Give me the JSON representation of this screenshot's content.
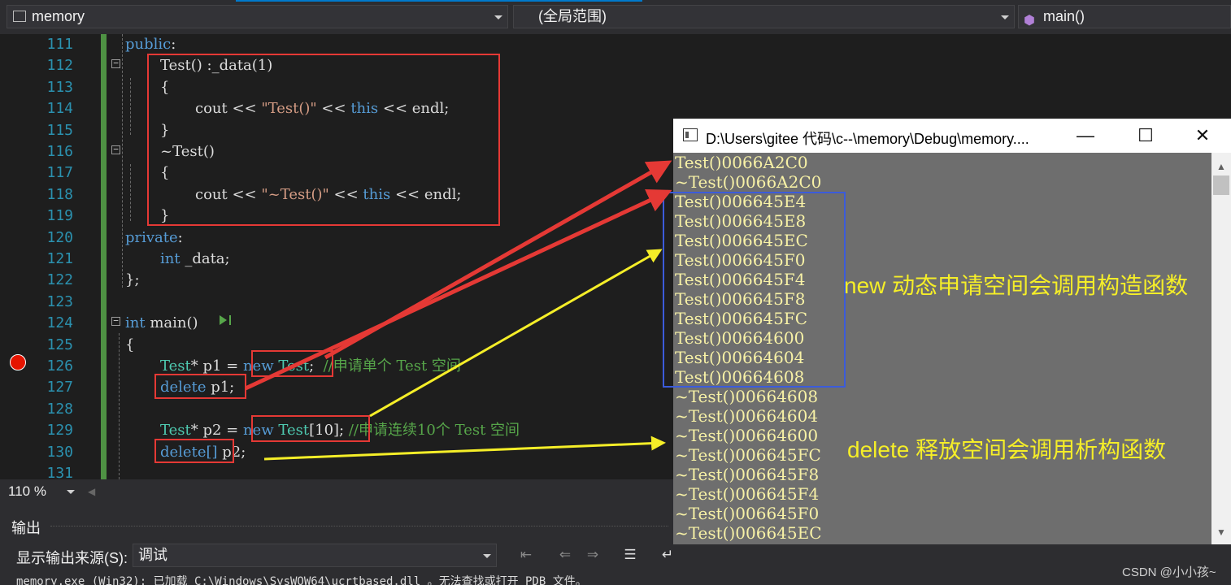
{
  "nav": {
    "scope_file": "memory",
    "scope_global": "(全局范围)",
    "scope_func": "main()"
  },
  "code_lines": [
    {
      "n": "111",
      "parts": [
        {
          "t": "public",
          "c": "kw"
        },
        {
          "t": ":",
          "c": "pl"
        }
      ]
    },
    {
      "n": "112",
      "parts": [
        {
          "t": "Test() :_data(1)",
          "c": "pl"
        }
      ]
    },
    {
      "n": "113",
      "parts": [
        {
          "t": "{",
          "c": "pl"
        }
      ]
    },
    {
      "n": "114",
      "parts": [
        {
          "t": "cout << ",
          "c": "pl"
        },
        {
          "t": "\"Test()\"",
          "c": "st"
        },
        {
          "t": " << ",
          "c": "pl"
        },
        {
          "t": "this",
          "c": "kw"
        },
        {
          "t": " << endl;",
          "c": "pl"
        }
      ]
    },
    {
      "n": "115",
      "parts": [
        {
          "t": "}",
          "c": "pl"
        }
      ]
    },
    {
      "n": "116",
      "parts": [
        {
          "t": "~Test()",
          "c": "pl"
        }
      ]
    },
    {
      "n": "117",
      "parts": [
        {
          "t": "{",
          "c": "pl"
        }
      ]
    },
    {
      "n": "118",
      "parts": [
        {
          "t": "cout << ",
          "c": "pl"
        },
        {
          "t": "\"~Test()\"",
          "c": "st"
        },
        {
          "t": " << ",
          "c": "pl"
        },
        {
          "t": "this",
          "c": "kw"
        },
        {
          "t": " << endl;",
          "c": "pl"
        }
      ]
    },
    {
      "n": "119",
      "parts": [
        {
          "t": "}",
          "c": "pl"
        }
      ]
    },
    {
      "n": "120",
      "parts": [
        {
          "t": "private",
          "c": "kw"
        },
        {
          "t": ":",
          "c": "pl"
        }
      ]
    },
    {
      "n": "121",
      "parts": [
        {
          "t": "int",
          "c": "kw"
        },
        {
          "t": " _data;",
          "c": "pl"
        }
      ]
    },
    {
      "n": "122",
      "parts": [
        {
          "t": "};",
          "c": "pl"
        }
      ]
    },
    {
      "n": "123",
      "parts": []
    },
    {
      "n": "124",
      "parts": [
        {
          "t": "int",
          "c": "kw"
        },
        {
          "t": " main()",
          "c": "pl"
        }
      ]
    },
    {
      "n": "125",
      "parts": [
        {
          "t": "{",
          "c": "pl"
        }
      ]
    },
    {
      "n": "126",
      "parts": [
        {
          "t": "Test",
          "c": "ty"
        },
        {
          "t": "* p1 = ",
          "c": "pl"
        },
        {
          "t": "new",
          "c": "kw"
        },
        {
          "t": " ",
          "c": "pl"
        },
        {
          "t": "Test",
          "c": "ty"
        },
        {
          "t": ";  ",
          "c": "pl"
        },
        {
          "t": "//申请单个 Test 空间",
          "c": "cm"
        }
      ]
    },
    {
      "n": "127",
      "parts": [
        {
          "t": "delete",
          "c": "kw"
        },
        {
          "t": " p1;",
          "c": "pl"
        }
      ]
    },
    {
      "n": "128",
      "parts": []
    },
    {
      "n": "129",
      "parts": [
        {
          "t": "Test",
          "c": "ty"
        },
        {
          "t": "* p2 = ",
          "c": "pl"
        },
        {
          "t": "new",
          "c": "kw"
        },
        {
          "t": " ",
          "c": "pl"
        },
        {
          "t": "Test",
          "c": "ty"
        },
        {
          "t": "[10]; ",
          "c": "pl"
        },
        {
          "t": "//申请连续10个 Test 空间",
          "c": "cm"
        }
      ]
    },
    {
      "n": "130",
      "parts": [
        {
          "t": "delete[]",
          "c": "kw"
        },
        {
          "t": " p2;",
          "c": "pl"
        }
      ]
    },
    {
      "n": "131",
      "parts": []
    }
  ],
  "zoom": "110 %",
  "output": {
    "title": "输出",
    "source_label": "显示输出来源(S):",
    "source_value": "调试",
    "text": "memory.exe (Win32): 已加载 C:\\Windows\\SysWOW64\\ucrtbased.dll 。无法查找或打开 PDB 文件。"
  },
  "console": {
    "title": "D:\\Users\\gitee 代码\\c--\\memory\\Debug\\memory....",
    "minimize": "—",
    "maximize": "☐",
    "close": "✕",
    "lines": [
      "Test()0066A2C0",
      "~Test()0066A2C0",
      "Test()006645E4",
      "Test()006645E8",
      "Test()006645EC",
      "Test()006645F0",
      "Test()006645F4",
      "Test()006645F8",
      "Test()006645FC",
      "Test()00664600",
      "Test()00664604",
      "Test()00664608",
      "~Test()00664608",
      "~Test()00664604",
      "~Test()00664600",
      "~Test()006645FC",
      "~Test()006645F8",
      "~Test()006645F4",
      "~Test()006645F0",
      "~Test()006645EC"
    ]
  },
  "annotations": {
    "new_note": "new 动态申请空间会调用构造函数",
    "delete_note": "delete 释放空间会调用析构函数"
  },
  "watermark": "CSDN @小小孩~",
  "colors": {
    "red": "#e53935",
    "yellow": "#f5ee28",
    "blue": "#3b5bdb"
  }
}
